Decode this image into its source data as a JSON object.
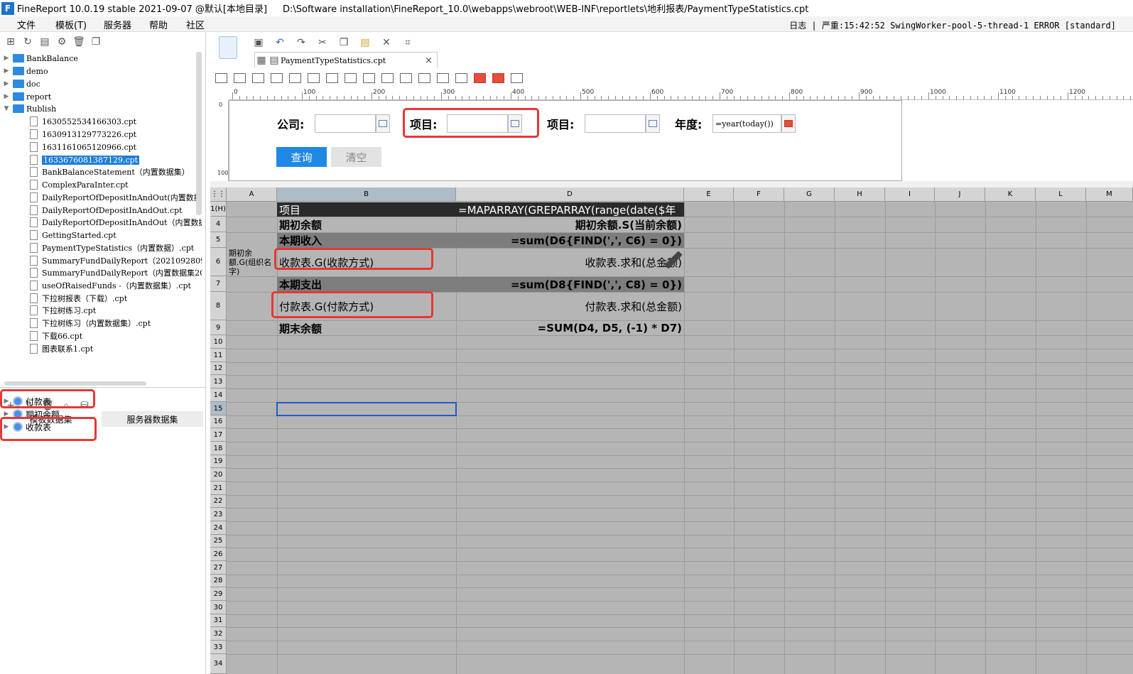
{
  "window": {
    "title": "FineReport 10.0.19 stable 2021-09-07 @默认[本地目录]",
    "path": "D:\\Software installation\\FineReport_10.0\\webapps\\webroot\\WEB-INF\\reportlets\\地利报表/PaymentTypeStatistics.cpt",
    "logo_letter": "F"
  },
  "menu": {
    "items": [
      "文件",
      "模板(T)",
      "服务器",
      "帮助",
      "社区"
    ],
    "log": "日志 | 严重:15:42:52 SwingWorker-pool-5-thread-1 ERROR [standard]"
  },
  "tree": {
    "folders": [
      "BankBalance",
      "demo",
      "doc",
      "report",
      "Rublish"
    ],
    "files": [
      "1630552534166303.cpt",
      "1630913129773226.cpt",
      "1631161065120966.cpt",
      "1633676081387129.cpt",
      "BankBalanceStatement（内置数据集）",
      "ComplexParaInter.cpt",
      "DailyReportOfDepositInAndOut(内置数据",
      "DailyReportOfDepositInAndOut.cpt",
      "DailyReportOfDepositInAndOut（内置数据",
      "GettingStarted.cpt",
      "PaymentTypeStatistics（内置数据）.cpt",
      "SummaryFundDailyReport（202109280954）",
      "SummaryFundDailyReport（内置数据集202",
      "useOfRaisedFunds -（内置数据集）.cpt",
      "下拉树报表（下载）.cpt",
      "下拉树练习.cpt",
      "下拉树练习（内置数据集）.cpt",
      "下载66.cpt",
      "图表联系1.cpt"
    ],
    "selected_file": "1633676081387129.cpt"
  },
  "datasets": {
    "tabs": [
      "模板数据集",
      "服务器数据集"
    ],
    "items": [
      "付款表",
      "期初余额",
      "收款表"
    ]
  },
  "editor": {
    "tab_label": "PaymentTypeStatistics.cpt",
    "close": "×"
  },
  "ruler": {
    "labels": [
      "0",
      "100",
      "200",
      "300",
      "400",
      "500",
      "600",
      "700",
      "800",
      "900",
      "1000",
      "1100",
      "1200"
    ],
    "vlabels": [
      "0",
      "100"
    ]
  },
  "params": {
    "company_label": "公司:",
    "project_label": "项目:",
    "project2_label": "项目:",
    "year_label": "年度:",
    "year_value": "=year(today())",
    "query_button": "查询",
    "clear_button": "清空"
  },
  "grid": {
    "columns": [
      "A",
      "B",
      "D",
      "E",
      "F",
      "G",
      "H",
      "I",
      "J",
      "K",
      "L",
      "M"
    ],
    "rows": [
      "1(H)",
      "4",
      "5",
      "6",
      "7",
      "8",
      "9",
      "10",
      "11",
      "12",
      "13",
      "14",
      "15",
      "16",
      "17",
      "18",
      "19",
      "20",
      "21",
      "22",
      "23",
      "24",
      "25",
      "26",
      "27",
      "28",
      "29",
      "30",
      "31",
      "32",
      "33",
      "34"
    ],
    "cells": {
      "a_merged": "期初余额.G(组织名字)",
      "b1": "项目",
      "d1": "=MAPARRAY(GREPARRAY(range(date($年",
      "b4": "期初余额",
      "d4": "期初余额.S(当前余额)",
      "b5": "本期收入",
      "d5": "=sum(D6{FIND(',', C6) = 0})",
      "b6": "收款表.G(收款方式)",
      "d6": "收款表.求和(总金额)",
      "b7": "本期支出",
      "d7": "=sum(D8{FIND(',', C8) = 0})",
      "b8": "付款表.G(付款方式)",
      "d8": "付款表.求和(总金额)",
      "b9": "期末余额",
      "d9": "=SUM(D4, D5, (-1) * D7)"
    }
  },
  "colors": {
    "accent": "#1f88e5",
    "highlight_red": "#e53935",
    "grid_bg": "#b5b5b5",
    "header_dark": "#2a2a2a"
  }
}
